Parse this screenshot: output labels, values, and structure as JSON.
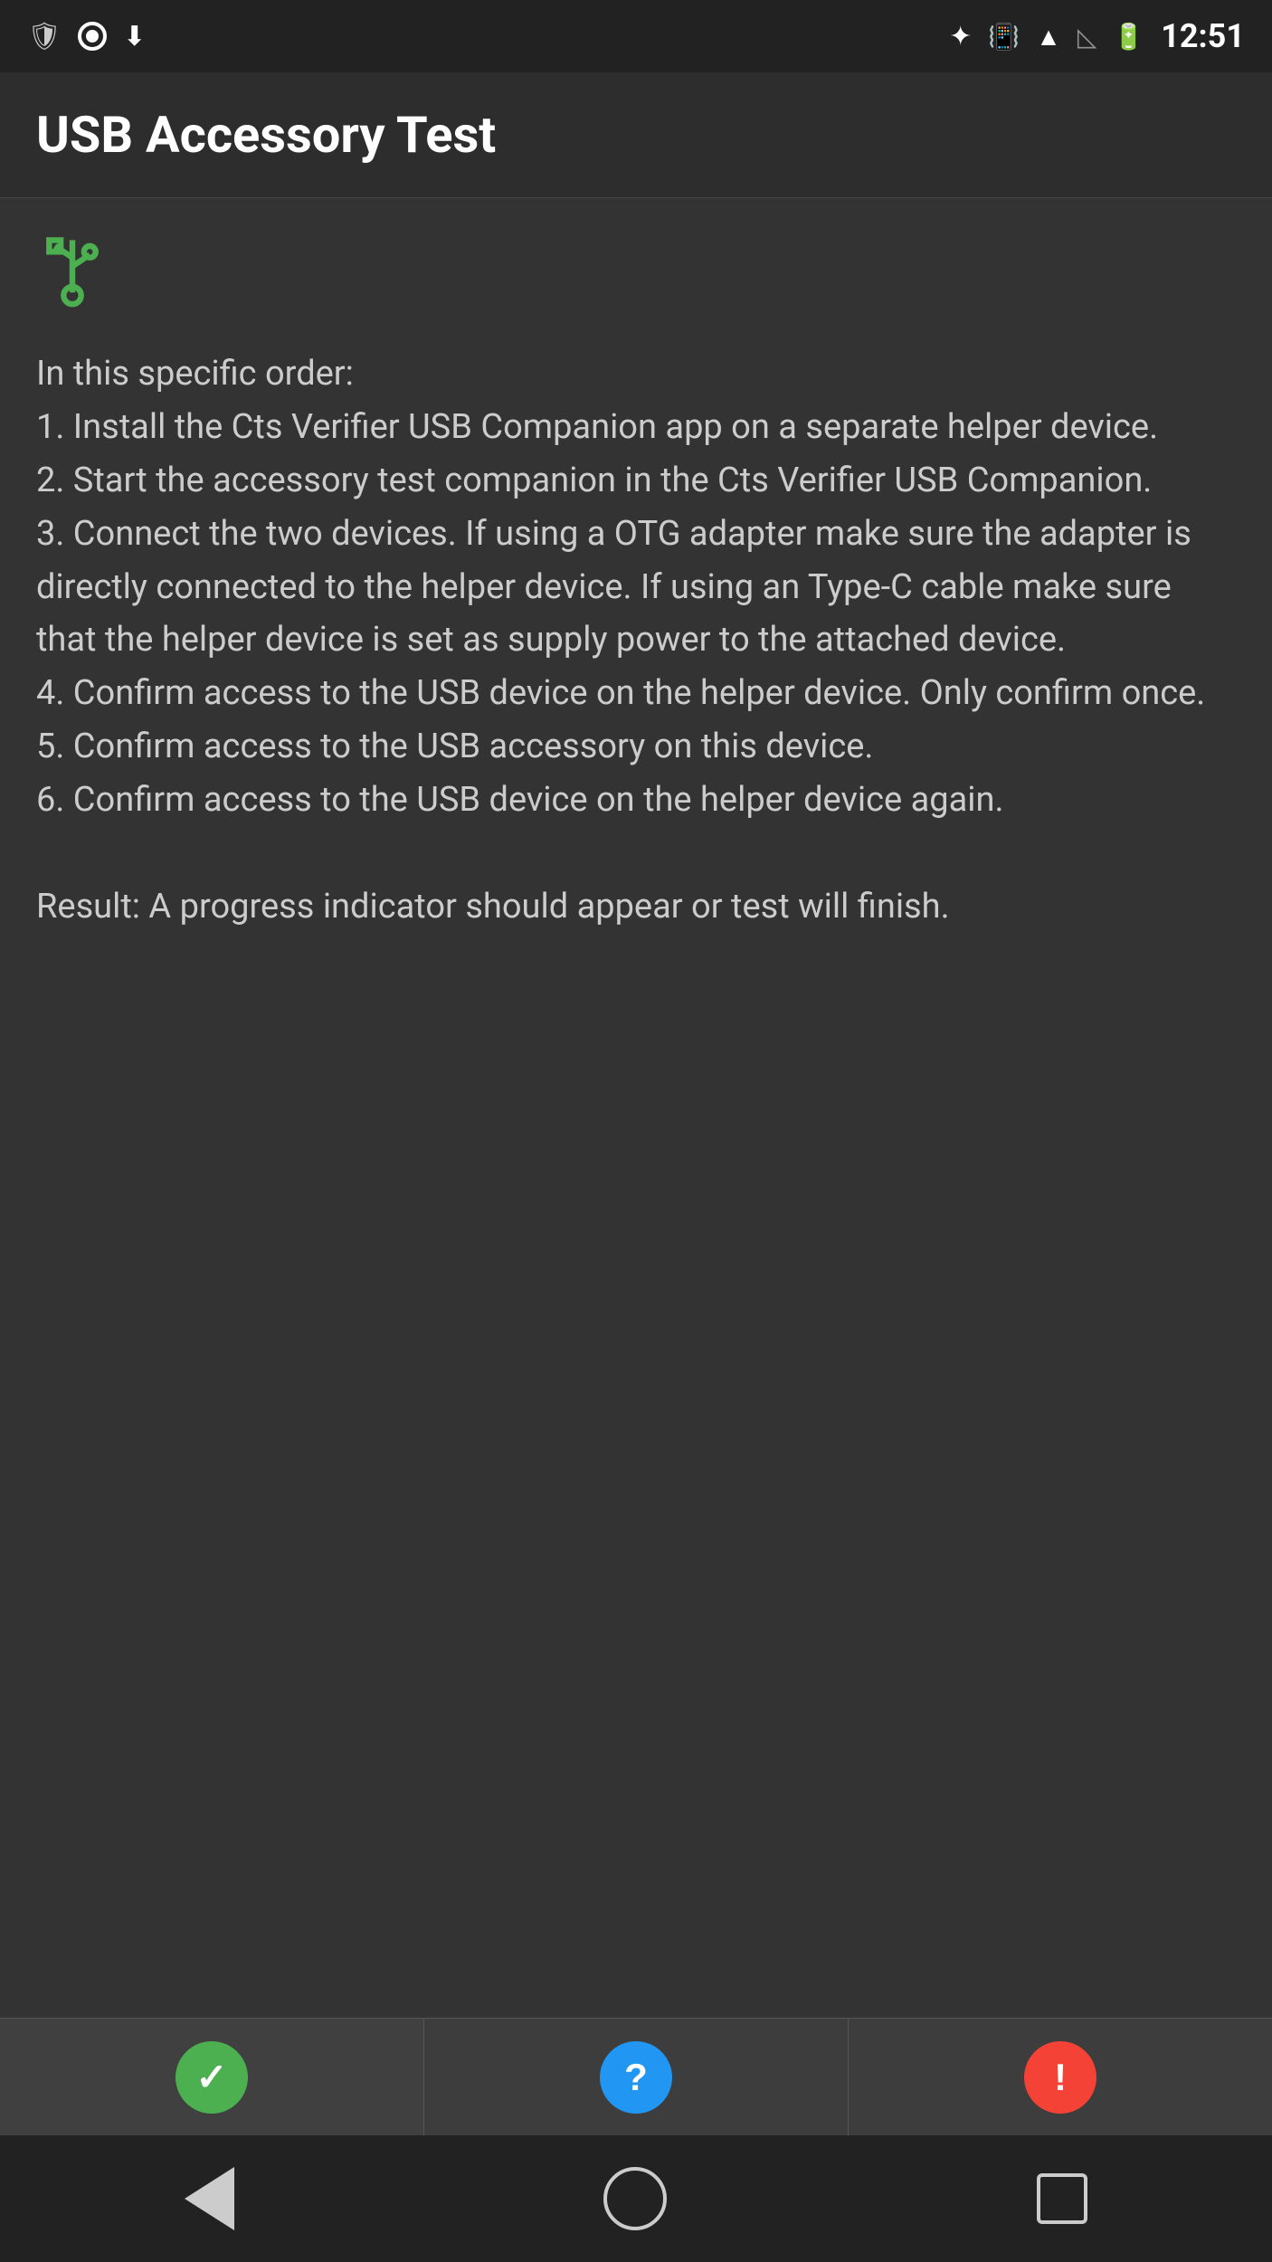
{
  "statusBar": {
    "time": "12:51",
    "leftIcons": [
      "shield-icon",
      "record-icon",
      "download-icon"
    ],
    "rightIcons": [
      "bluetooth-icon",
      "vibrate-icon",
      "wifi-icon",
      "signal-off-icon",
      "battery-icon"
    ]
  },
  "appBar": {
    "title": "USB Accessory Test"
  },
  "content": {
    "usbIconLabel": "USB",
    "instructions": "In this specific order:\n1. Install the Cts Verifier USB Companion app on a separate helper device.\n2. Start the accessory test companion in the Cts Verifier USB Companion.\n3. Connect the two devices. If using a OTG adapter make sure the adapter is directly connected to the helper device. If using an Type-C cable make sure that the helper device is set as supply power to the attached device.\n4. Confirm access to the USB device on the helper device. Only confirm once.\n5. Confirm access to the USB accessory on this device.\n6. Confirm access to the USB device on the helper device again.\n\nResult: A progress indicator should appear or test will finish."
  },
  "bottomButtons": [
    {
      "id": "pass-button",
      "icon": "✓",
      "color": "green",
      "label": "Pass"
    },
    {
      "id": "info-button",
      "icon": "?",
      "color": "blue",
      "label": "Info"
    },
    {
      "id": "fail-button",
      "icon": "!",
      "color": "red",
      "label": "Fail"
    }
  ],
  "navBar": {
    "backLabel": "Back",
    "homeLabel": "Home",
    "recentLabel": "Recent"
  }
}
